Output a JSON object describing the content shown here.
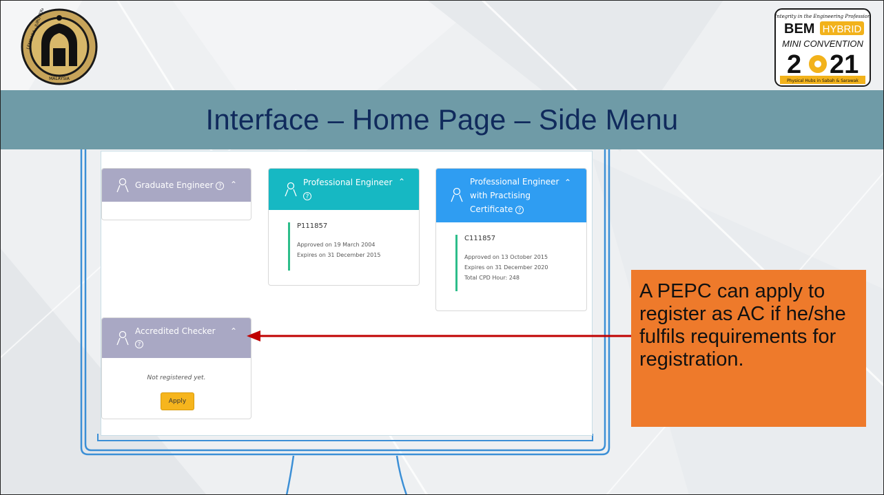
{
  "slide": {
    "title": "Interface – Home Page – Side Menu",
    "callout": "A PEPC can apply to register as AC if he/she fulfils requirements for registration.",
    "colors": {
      "title_band": "#6f9ba7",
      "title_text": "#102a5c",
      "callout_bg": "#ee7a2b",
      "arrow": "#c00000"
    }
  },
  "logos": {
    "left": {
      "icon": "lembaga-jurutera-malaysia-seal-icon",
      "ring_top": "LEMBAGA · JURUTERA",
      "ring_bottom": "MALAYSIA"
    },
    "right": {
      "icon": "bem-hybrid-mini-convention-logo",
      "tagline": "Integrity in the Engineering Profession",
      "brand": "BEM",
      "hybrid": "HYBRID",
      "convention": "MINI CONVENTION",
      "year_left": "2",
      "year_right": "21",
      "footer": "Physical Hubs in Sabah & Sarawak"
    }
  },
  "cards": {
    "graduate": {
      "title": "Graduate Engineer",
      "help": "?",
      "icon": "person-icon"
    },
    "professional": {
      "title": "Professional Engineer",
      "help": "?",
      "reg_no": "P111857",
      "approved": "Approved on 19 March 2004",
      "expires": "Expires on 31 December 2015"
    },
    "pepc": {
      "title_line1": "Professional Engineer",
      "title_line2": "with Practising",
      "title_line3": "Certificate",
      "help": "?",
      "reg_no": "C111857",
      "approved": "Approved on 13 October 2015",
      "expires": "Expires on 31 December 2020",
      "cpd": "Total CPD Hour: 248"
    },
    "accredited": {
      "title": "Accredited Checker",
      "help": "?",
      "status": "Not registered yet.",
      "apply_label": "Apply"
    }
  }
}
